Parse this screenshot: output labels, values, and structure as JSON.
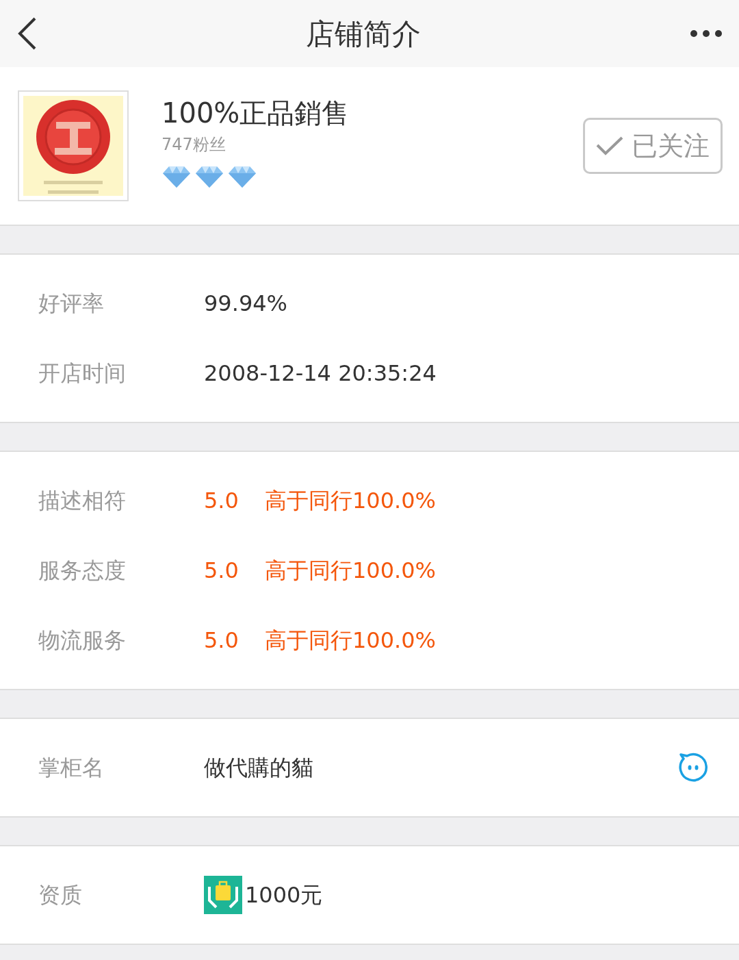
{
  "header": {
    "title": "店铺简介"
  },
  "shop": {
    "name": "100%正品銷售",
    "fans": "747粉丝",
    "stars": 3,
    "follow_button": {
      "label": "已关注",
      "followed": true
    }
  },
  "sections": [
    {
      "rows": [
        {
          "kind": "text",
          "label": "好评率",
          "value": "99.94%"
        },
        {
          "kind": "text",
          "label": "开店时间",
          "value": "2008-12-14 20:35:24"
        }
      ]
    },
    {
      "rows": [
        {
          "kind": "score",
          "label": "描述相符",
          "score": "5.0",
          "compare": "高于同行100.0%"
        },
        {
          "kind": "score",
          "label": "服务态度",
          "score": "5.0",
          "compare": "高于同行100.0%"
        },
        {
          "kind": "score",
          "label": "物流服务",
          "score": "5.0",
          "compare": "高于同行100.0%"
        }
      ]
    },
    {
      "rows": [
        {
          "kind": "chat",
          "label": "掌柜名",
          "value": "做代購的貓"
        }
      ]
    },
    {
      "rows": [
        {
          "kind": "deposit",
          "label": "资质",
          "value": "1000元"
        }
      ]
    }
  ]
}
